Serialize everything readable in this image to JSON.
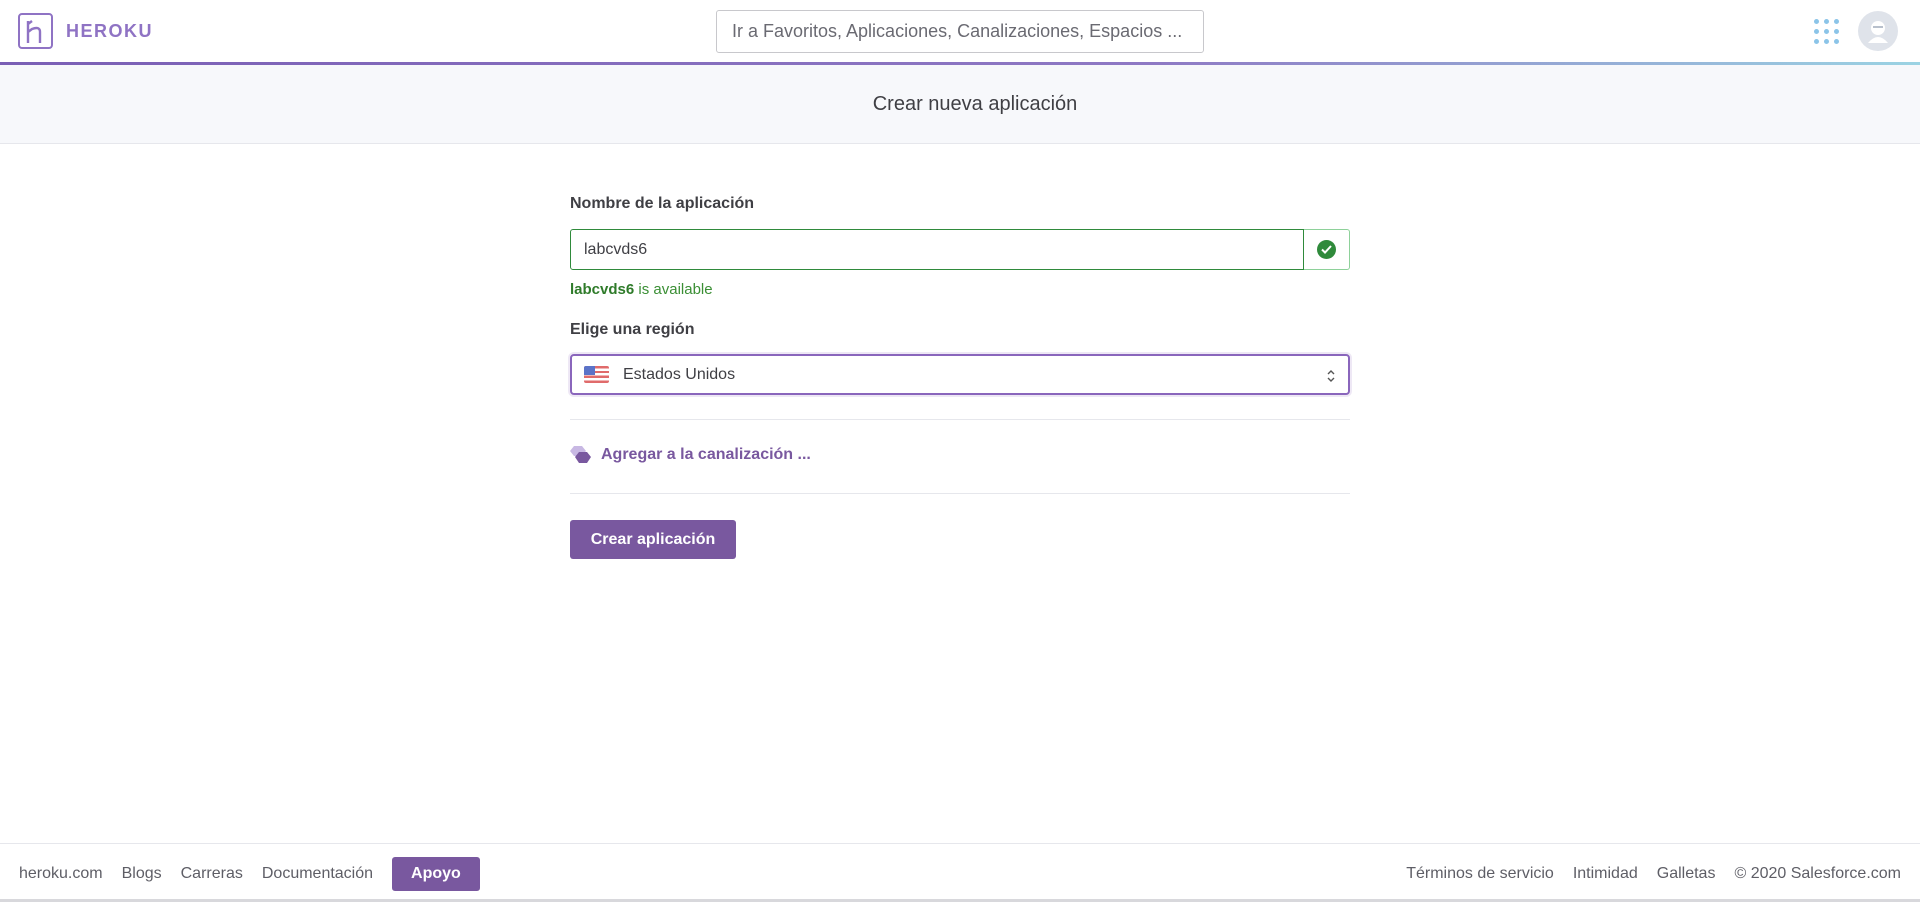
{
  "header": {
    "brand": "HEROKU",
    "search_placeholder": "Ir a Favoritos, Aplicaciones, Canalizaciones, Espacios ..."
  },
  "subheader": {
    "title": "Crear nueva aplicación"
  },
  "form": {
    "app_name_label": "Nombre de la aplicación",
    "app_name_value": "labcvds6",
    "availability_name": "labcvds6",
    "availability_suffix": " is available",
    "region_label": "Elige una región",
    "region_value": "Estados Unidos",
    "pipeline_link": "Agregar a la canalización ...",
    "create_button": "Crear aplicación"
  },
  "footer": {
    "links_left": [
      "heroku.com",
      "Blogs",
      "Carreras",
      "Documentación"
    ],
    "support_button": "Apoyo",
    "links_right": [
      "Términos de servicio",
      "Intimidad",
      "Galletas"
    ],
    "copyright": "© 2020 Salesforce.com"
  },
  "colors": {
    "brand_purple": "#79589f",
    "success_green": "#2f8a3b"
  }
}
